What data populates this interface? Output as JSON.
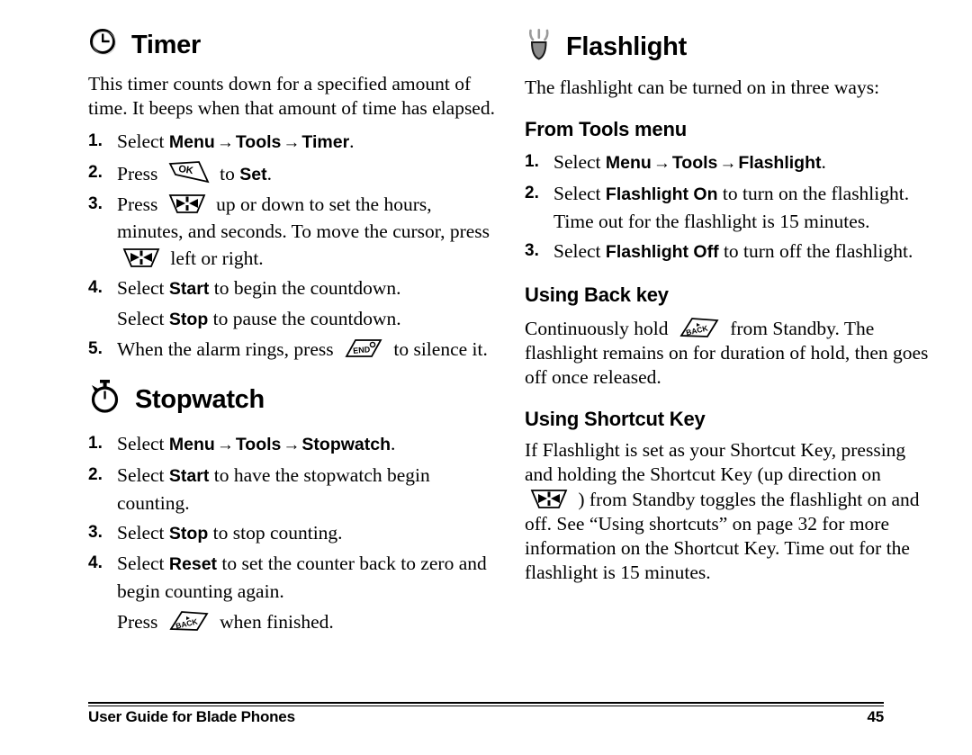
{
  "page": {
    "footer_title": "User Guide for Blade Phones",
    "page_number": "45"
  },
  "left_column": {
    "timer": {
      "heading": "Timer",
      "icon": "clock-icon",
      "intro": "This timer counts down for a specified amount of time. It beeps when that amount of time has elapsed.",
      "steps": [
        {
          "num": "1.",
          "pre": "Select ",
          "ui1": "Menu",
          "arrow1": "→",
          "ui2": "Tools",
          "arrow2": "→",
          "ui3": "Timer",
          "post": "."
        },
        {
          "num": "2.",
          "pre": "Press ",
          "icon": "ok-key-icon",
          "mid": " to ",
          "ui1": "Set",
          "post": "."
        },
        {
          "num": "3.",
          "pre": "Press ",
          "icon": "navigation-key-icon",
          "mid": " up or down to set the hours, minutes, and seconds. To move the cursor, press ",
          "icon2": "navigation-key-icon",
          "post": " left or right."
        },
        {
          "num": "4.",
          "pre": "Select ",
          "ui1": "Start",
          "post": " to begin the countdown."
        },
        {
          "num": "5.",
          "pre": "When the alarm rings, press ",
          "icon": "end-key-icon",
          "post": " to silence it."
        }
      ],
      "step4_sub": {
        "pre": "Select ",
        "ui1": "Stop",
        "post": " to pause the countdown."
      }
    },
    "stopwatch": {
      "heading": "Stopwatch",
      "icon": "stopwatch-icon",
      "steps": [
        {
          "num": "1.",
          "pre": "Select ",
          "ui1": "Menu",
          "arrow1": "→",
          "ui2": "Tools",
          "arrow2": "→",
          "ui3": "Stopwatch",
          "post": "."
        },
        {
          "num": "2.",
          "pre": "Select ",
          "ui1": "Start",
          "post": " to have the stopwatch begin counting."
        },
        {
          "num": "3.",
          "pre": "Select ",
          "ui1": "Stop",
          "post": " to stop counting."
        },
        {
          "num": "4.",
          "pre": "Select ",
          "ui1": "Reset",
          "post": " to set the counter back to zero and begin counting again."
        }
      ],
      "step4_sub": {
        "pre": "Press ",
        "icon": "back-key-icon",
        "post": " when finished."
      }
    }
  },
  "right_column": {
    "flashlight": {
      "heading": "Flashlight",
      "icon": "flashlight-icon",
      "intro": "The flashlight can be turned on in three ways:"
    },
    "from_tools_menu": {
      "heading": "From Tools menu",
      "steps": [
        {
          "num": "1.",
          "pre": "Select ",
          "ui1": "Menu",
          "arrow1": "→",
          "ui2": "Tools",
          "arrow2": "→",
          "ui3": "Flashlight",
          "post": "."
        },
        {
          "num": "2.",
          "pre": "Select ",
          "ui1": "Flashlight On",
          "post": " to turn on the flashlight. Time out for the flashlight is 15 minutes."
        },
        {
          "num": "3.",
          "pre": "Select ",
          "ui1": "Flashlight Off",
          "post": " to turn off the flashlight."
        }
      ]
    },
    "using_back_key": {
      "heading": "Using Back key",
      "pre": "Continuously hold ",
      "icon": "back-key-icon",
      "post": " from Standby. The flashlight remains on for duration of hold, then goes off once released."
    },
    "using_shortcut_key": {
      "heading": "Using Shortcut Key",
      "pre": "If Flashlight is set as your Shortcut Key, pressing and holding the Shortcut Key (up direction on ",
      "icon": "navigation-key-icon",
      "post": " ) from Standby toggles the flashlight on and off. See “Using shortcuts” on page 32 for more information on the Shortcut Key. Time out for the flashlight is 15 minutes."
    }
  }
}
